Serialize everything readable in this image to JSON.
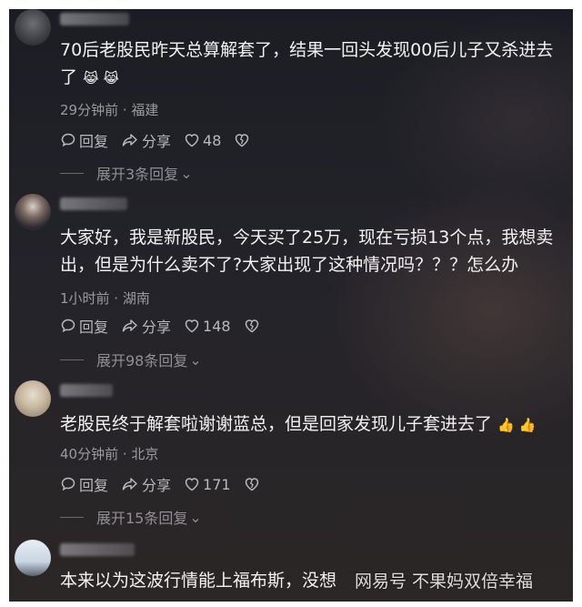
{
  "comments": [
    {
      "text": "70后老股民昨天总算解套了，结果一回头发现00后儿子又杀进去了",
      "emoji": "😹 😹",
      "meta": "29分钟前 · 福建",
      "reply": "回复",
      "share": "分享",
      "likes": "48",
      "expand": "展开3条回复"
    },
    {
      "text": "大家好，我是新股民，今天买了25万，现在亏损13个点，我想卖出，但是为什么卖不了?大家出现了这种情况吗？？？怎么办",
      "meta": "1小时前 · 湖南",
      "reply": "回复",
      "share": "分享",
      "likes": "148",
      "expand": "展开98条回复"
    },
    {
      "text": "老股民终于解套啦谢谢蓝总，但是回家发现儿子套进去了",
      "emoji": "👍 👍",
      "meta": "40分钟前 · 北京",
      "reply": "回复",
      "share": "分享",
      "likes": "171",
      "expand": "展开15条回复"
    },
    {
      "text": "本来以为这波行情能上福布斯，没想"
    }
  ],
  "watermark": "网易号 不果妈双倍幸福"
}
